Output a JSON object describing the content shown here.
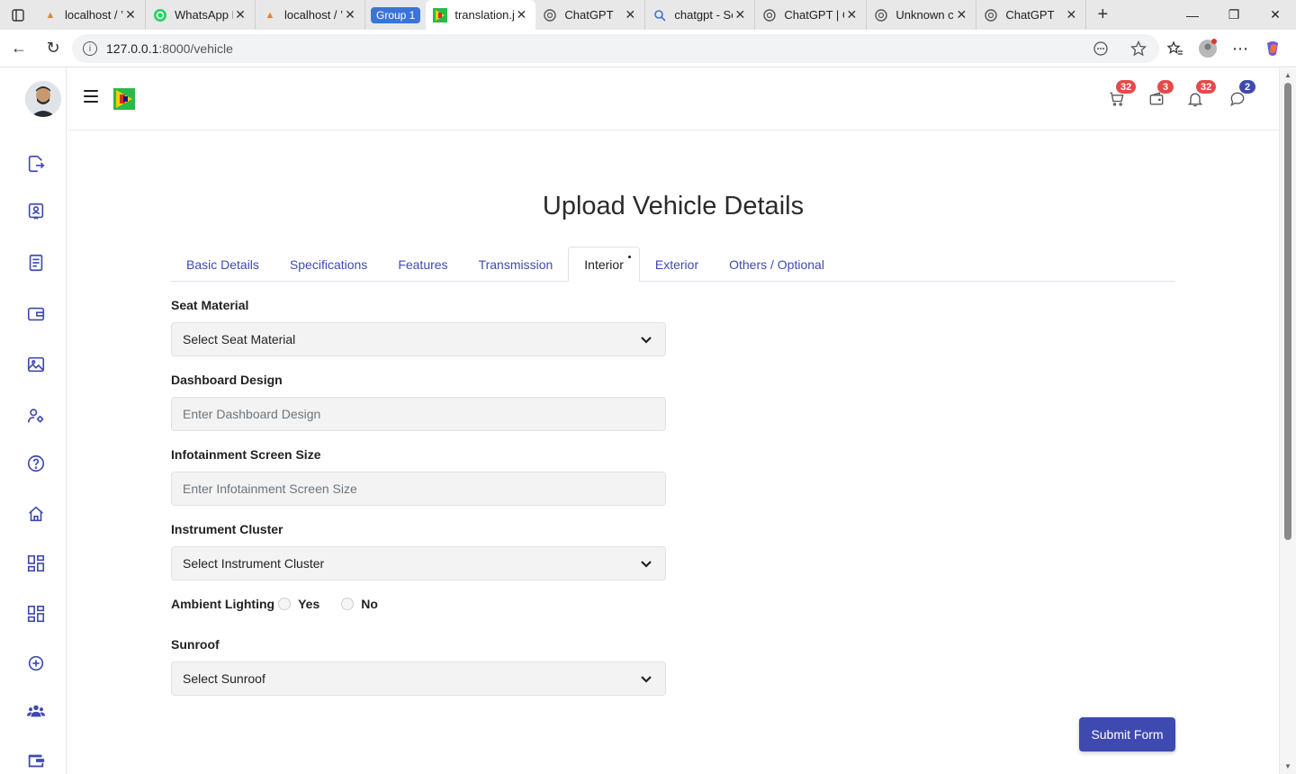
{
  "browser": {
    "tabs": [
      {
        "title": "localhost / ’",
        "icon": "phpmyadmin-icon"
      },
      {
        "title": "WhatsApp E",
        "icon": "whatsapp-icon"
      },
      {
        "title": "localhost / ’",
        "icon": "phpmyadmin-icon"
      },
      {
        "title": "translation.j",
        "icon": "site-logo-icon"
      },
      {
        "title": "ChatGPT",
        "icon": "chatgpt-icon"
      },
      {
        "title": "chatgpt - Se",
        "icon": "search-icon"
      },
      {
        "title": "ChatGPT | C",
        "icon": "chatgpt-icon"
      },
      {
        "title": "Unknown cc",
        "icon": "chatgpt-icon"
      },
      {
        "title": "ChatGPT",
        "icon": "chatgpt-icon"
      }
    ],
    "group_label": "Group 1",
    "url_host": "127.0.0.1",
    "url_path": ":8000/vehicle"
  },
  "header": {
    "badges": {
      "cart": "32",
      "wallet": "3",
      "notifications": "32",
      "messages": "2"
    }
  },
  "page": {
    "title": "Upload Vehicle Details",
    "tabs": [
      {
        "label": "Basic Details"
      },
      {
        "label": "Specifications"
      },
      {
        "label": "Features"
      },
      {
        "label": "Transmission"
      },
      {
        "label": "Interior"
      },
      {
        "label": "Exterior"
      },
      {
        "label": "Others / Optional"
      }
    ],
    "active_tab": "Interior",
    "form": {
      "seat_material": {
        "label": "Seat Material",
        "value": "Select Seat Material"
      },
      "dashboard_design": {
        "label": "Dashboard Design",
        "placeholder": "Enter Dashboard Design"
      },
      "infotainment": {
        "label": "Infotainment Screen Size",
        "placeholder": "Enter Infotainment Screen Size"
      },
      "instrument_cluster": {
        "label": "Instrument Cluster",
        "value": "Select Instrument Cluster"
      },
      "ambient_lighting": {
        "label": "Ambient Lighting",
        "yes": "Yes",
        "no": "No"
      },
      "sunroof": {
        "label": "Sunroof",
        "value": "Select Sunroof"
      }
    },
    "submit_label": "Submit Form"
  },
  "colors": {
    "accent": "#3f4ab0",
    "badge_red": "#e54a4a",
    "tab_group": "#3b74d8"
  }
}
